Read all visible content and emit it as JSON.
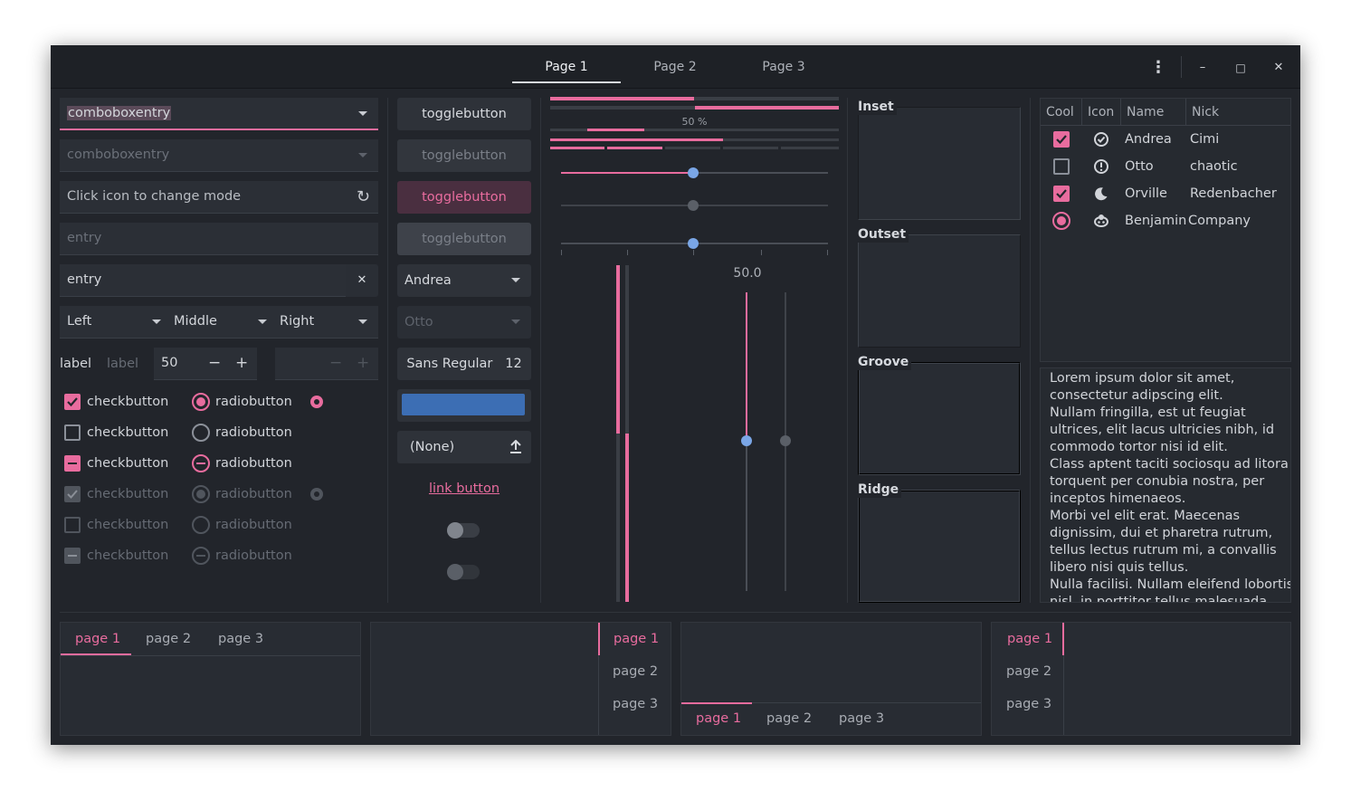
{
  "headerbar": {
    "tabs": [
      "Page 1",
      "Page 2",
      "Page 3"
    ],
    "buttons": {
      "menu": "⋮",
      "minimize": "–",
      "maximize": "□",
      "close": "✕"
    }
  },
  "col1": {
    "combo1": "comboboxentry",
    "combo2": "comboboxentry",
    "mode_entry": "Click icon to change mode",
    "entry_placeholder": "entry",
    "entry_value": "entry",
    "clear_icon": "✕",
    "refresh_icon": "↻",
    "combos": [
      "Left",
      "Middle",
      "Right"
    ],
    "label1": "label",
    "label2": "label",
    "spin_value": "50",
    "spin_minus": "−",
    "spin_plus": "+",
    "checks": [
      "checkbutton",
      "checkbutton",
      "checkbutton",
      "checkbutton",
      "checkbutton",
      "checkbutton"
    ],
    "radios": [
      "radiobutton",
      "radiobutton",
      "radiobutton",
      "radiobutton",
      "radiobutton",
      "radiobutton"
    ]
  },
  "col2": {
    "toggles": [
      "togglebutton",
      "togglebutton",
      "togglebutton",
      "togglebutton"
    ],
    "combo_andrea": "Andrea",
    "combo_otto": "Otto",
    "font_name": "Sans Regular",
    "font_size": "12",
    "file_none": "(None)",
    "link": "link button"
  },
  "col3": {
    "progress_label": "50 %",
    "scale_value": "50.0"
  },
  "col4": {
    "frames": [
      "Inset",
      "Outset",
      "Groove",
      "Ridge"
    ]
  },
  "col5": {
    "headers": [
      "Cool",
      "Icon",
      "Name",
      "Nick"
    ],
    "rows": [
      {
        "name": "Andrea",
        "nick": "Cimi",
        "icon": "check-circle-icon"
      },
      {
        "name": "Otto",
        "nick": "chaotic",
        "icon": "warning-icon"
      },
      {
        "name": "Orville",
        "nick": "Redenbacher",
        "icon": "moon-icon"
      },
      {
        "name": "Benjamin",
        "nick": "Company",
        "icon": "face-icon"
      }
    ],
    "text": [
      "Lorem ipsum dolor sit amet,",
      "consectetur adipscing elit.",
      "Nullam fringilla, est ut feugiat",
      "ultrices, elit lacus ultricies nibh, id",
      "commodo tortor nisi id elit.",
      "Class aptent taciti sociosqu ad litora",
      "torquent per conubia nostra, per",
      "inceptos himenaeos.",
      "Morbi vel elit erat. Maecenas",
      "dignissim, dui et pharetra rutrum,",
      "tellus lectus rutrum mi, a convallis",
      "libero nisi quis tellus.",
      "Nulla facilisi. Nullam eleifend lobortis",
      "nisl, in porttitor tellus malesuada"
    ]
  },
  "notebooks": {
    "pages": [
      "page 1",
      "page 2",
      "page 3"
    ]
  },
  "colors": {
    "accent": "#e86c9e",
    "blue": "#7aa6e6",
    "bg": "#22252b"
  }
}
